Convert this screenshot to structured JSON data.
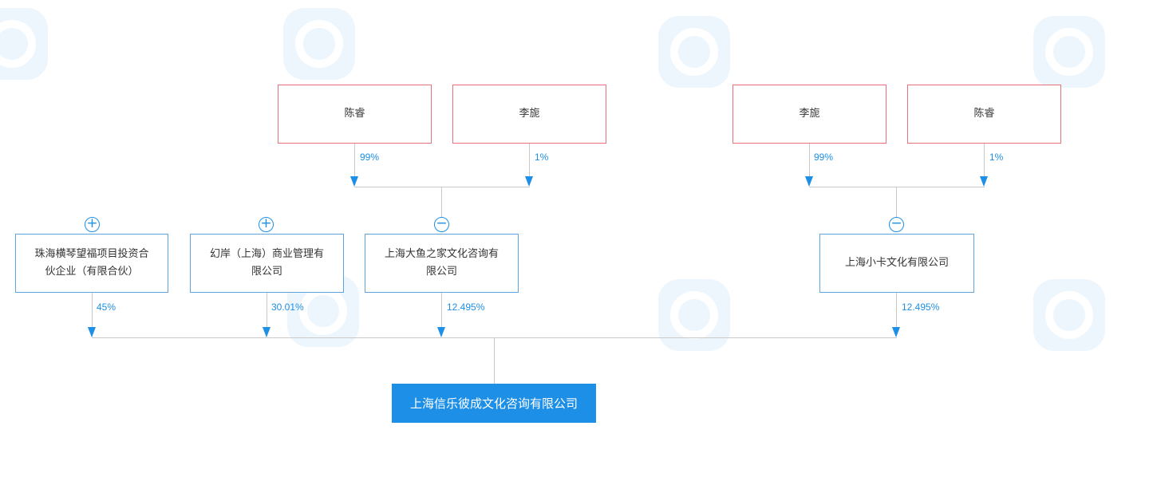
{
  "watermark": {
    "brand": "qcc.com"
  },
  "persons": [
    {
      "id": "p1",
      "name": "陈睿"
    },
    {
      "id": "p2",
      "name": "李旎"
    },
    {
      "id": "p3",
      "name": "李旎"
    },
    {
      "id": "p4",
      "name": "陈睿"
    }
  ],
  "person_shares": [
    "99%",
    "1%",
    "99%",
    "1%"
  ],
  "shareholders": [
    {
      "name_line1": "珠海横琴望福项目投资合",
      "name_line2": "伙企业（有限合伙）",
      "share": "45%",
      "toggle": "+"
    },
    {
      "name_line1": "幻岸（上海）商业管理有",
      "name_line2": "限公司",
      "share": "30.01%",
      "toggle": "+"
    },
    {
      "name_line1": "上海大鱼之家文化咨询有",
      "name_line2": "限公司",
      "share": "12.495%",
      "toggle": "−"
    },
    {
      "name_line1": "上海小卡文化有限公司",
      "name_line2": "",
      "share": "12.495%",
      "toggle": "−"
    }
  ],
  "target": {
    "name": "上海信乐彼成文化咨询有限公司"
  },
  "colors": {
    "person_border": "#e8707a",
    "company_border": "#5da4de",
    "accent": "#1d8fe6",
    "line": "#c9c9c9"
  }
}
